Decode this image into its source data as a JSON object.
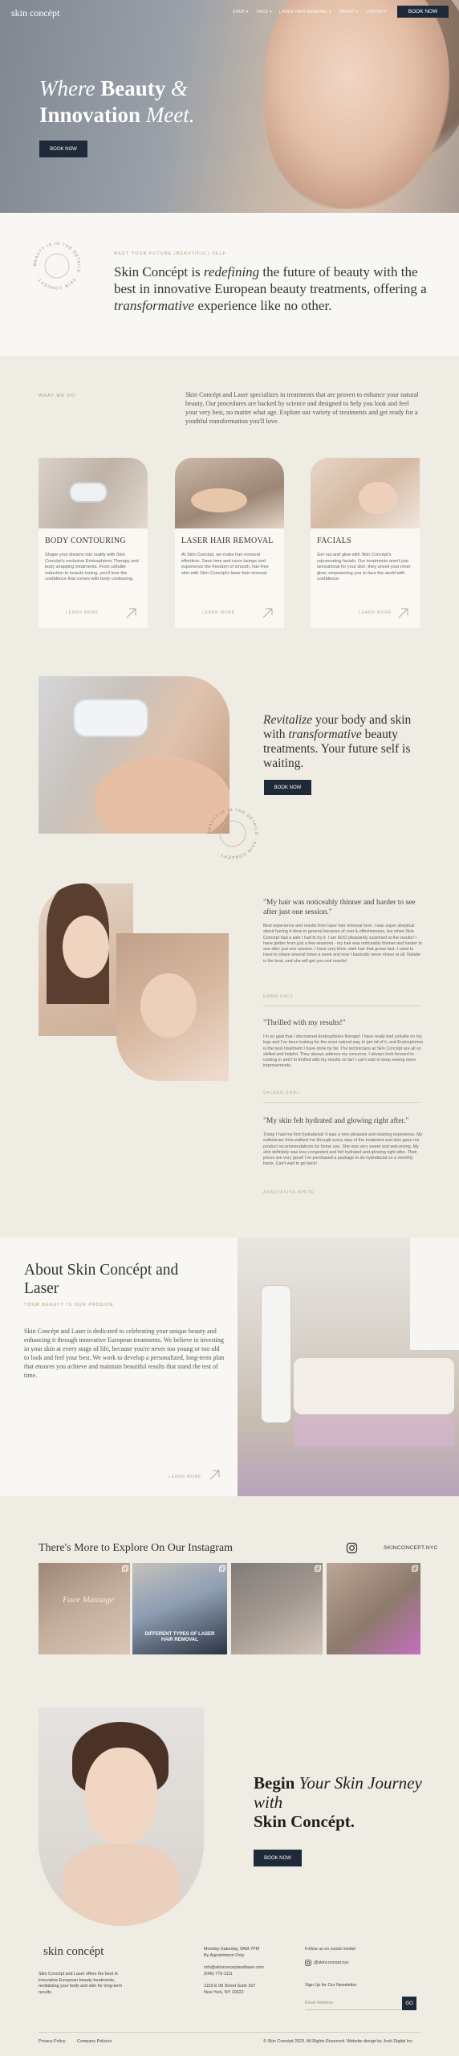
{
  "brand": {
    "logo": "skin concépt",
    "accent": "#1e2a39",
    "gold": "#b59c7d"
  },
  "nav": {
    "items": [
      "SHOP",
      "FACE",
      "LASER HAIR REMOVAL",
      "ABOUT",
      "CONTACT"
    ],
    "book": "BOOK NOW"
  },
  "hero": {
    "line1_italic": "Where",
    "line1_bold": "Beauty",
    "line1_amp": "&",
    "line2_bold": "Innovation",
    "line2_italic": "Meet.",
    "button": "BOOK NOW"
  },
  "intro": {
    "circle_text": "BEAUTY IS IN THE DETAILS · SKIN CONCÉPT ·",
    "eyebrow": "MEET YOUR FUTURE (BEAUTIFUL) SELF",
    "p1": "Skin Concépt is ",
    "p1_em": "redefining",
    "p2": " the future of beauty with the best in innovative European beauty treatments, offering a ",
    "p2_em": "transformative",
    "p3": " experience like no other."
  },
  "what_we_do": {
    "eyebrow": "WHAT WE DO",
    "paragraph": "Skin Concépt and Laser specializes in treatments that are proven to enhance your natural beauty. Our procedures are backed by science and designed to help you look and feel your very best, no matter what age. Explore our variety of treatments and get ready for a youthful transformation you'll love.",
    "services": [
      {
        "title": "BODY CONTOURING",
        "desc": "Shape your dreams into reality with Skin Concépt's exclusive Endosphéres Therapy and body wrapping treatments. From cellulite reduction to muscle toning, you'll love the confidence that comes with body contouring.",
        "learn": "LEARN MORE"
      },
      {
        "title": "LASER HAIR REMOVAL",
        "desc": "At Skin Concépt, we make hair removal effortless. Save time and razor bumps and experience the freedom of smooth, hair-free skin with Skin Concépt's laser hair removal.",
        "learn": "LEARN MORE"
      },
      {
        "title": "FACIALS",
        "desc": "Get out and glow with Skin Concépt's rejuvenating facials. Our treatments aren't just sensational for your skin; they unveil your inner glow, empowering you to face the world with confidence.",
        "learn": "LEARN MORE"
      }
    ]
  },
  "revitalize": {
    "em1": "Revitalize",
    "t1": " your body and skin with ",
    "em2": "transformative",
    "t2": " beauty treatments. Your future self is waiting.",
    "button": "BOOK NOW",
    "circle_text": "BEAUTY IS IN THE DETAILS · SKIN CONCÉPT ·"
  },
  "testimonials": [
    {
      "quote": "\"My hair was noticeably thinner and harder to see after just one session.\"",
      "body": "Best experience and results from laser hair removal here. I was super skeptical about having it done in general because of cost & effectiveness, but when Skin Concépt had a sale I had to try it. I am SOO pleasantly surprised at the results! I have gotten from just a few sessions - my hair was noticeably thinner and harder to see after just one session. I have very thick, dark hair that grows fast. I used to have to shave several times a week and now I basically never shave at all. Natalie is the best, and she will get you real results!",
      "name": "EMMA KATZ"
    },
    {
      "quote": "\"Thrilled with my results!\"",
      "body": "I'm so glad that I discovered Endosphéres therapy! I have really bad cellulite on my legs and I've been looking for the most natural way to get rid of it, and Endosphéres is the best treatment I have done by far. The technicians at Skin Concépt are all so skilled and helpful. They always address my concerns. I always look forward to coming in and I'm thrilled with my results so far! I can't wait to keep seeing more improvements.",
      "name": "SALEEN SHAJ"
    },
    {
      "quote": "\"My skin felt hydrated and glowing right after.\"",
      "body": "Today I had my first hydrafacial! It was a very pleasant and relaxing experience. My esthetician Irina walked me through every step of the treatment and also gave me product recommendations for home use. She was very sweet and welcoming. My skin definitely was less congested and felt hydrated and glowing right after. Their prices are very good! I've purchased a package to do hydrafacial on a monthly basis. Can't wait to go back!",
      "name": "ANASTASIYA WHITE"
    }
  ],
  "about": {
    "title": "About Skin Concépt and Laser",
    "eyebrow": "YOUR BEAUTY IS OUR PASSION",
    "paragraph": "Skin Concépt and Laser is dedicated to celebrating your unique beauty and enhancing it through innovative European treatments. We believe in investing in your skin at every stage of life, because you're never too young or too old to look and feel your best. We work to develop a personalized, long-term plan that ensures you achieve and maintain beautiful results that stand the test of time.",
    "learn": "LEARN MORE"
  },
  "instagram": {
    "title": "There's More to Explore On Our Instagram",
    "handle": "SKINCONCEPT.NYC",
    "tiles": [
      {
        "caption": "Face Massage"
      },
      {
        "caption": "DIFFERENT TYPES OF LASER HAIR REMOVAL"
      },
      {
        "caption": ""
      },
      {
        "caption": ""
      }
    ]
  },
  "cta": {
    "b1": "Begin",
    "i1": "Your Skin Journey with",
    "b2": "Skin Concépt.",
    "button": "BOOK NOW"
  },
  "footer": {
    "logo": "skin concépt",
    "about": "Skin Concépt and Laser offers the best in innovative European beauty treatments, revitalizing your body and skin for long-term results.",
    "hours1": "Monday-Saturday, 9AM-7PM",
    "hours2": "By Appointment Only",
    "email": "info@skinconceptandlaser.com",
    "phone": "(646) 770-1111",
    "addr1": "1153 E 08 Street Suite 307",
    "addr2": "New York, NY 10022",
    "follow": "Follow us on social media!",
    "social": "@skinconcept.nyc",
    "signup": "Sign Up for Our Newsletter",
    "email_placeholder": "Email Address",
    "go": "GO",
    "privacy": "Privacy Policy",
    "policies": "Company Policies",
    "copyright": "© Skin Concépt 2023. All Rights Reserved. Website design by Josh Digital Inc."
  }
}
